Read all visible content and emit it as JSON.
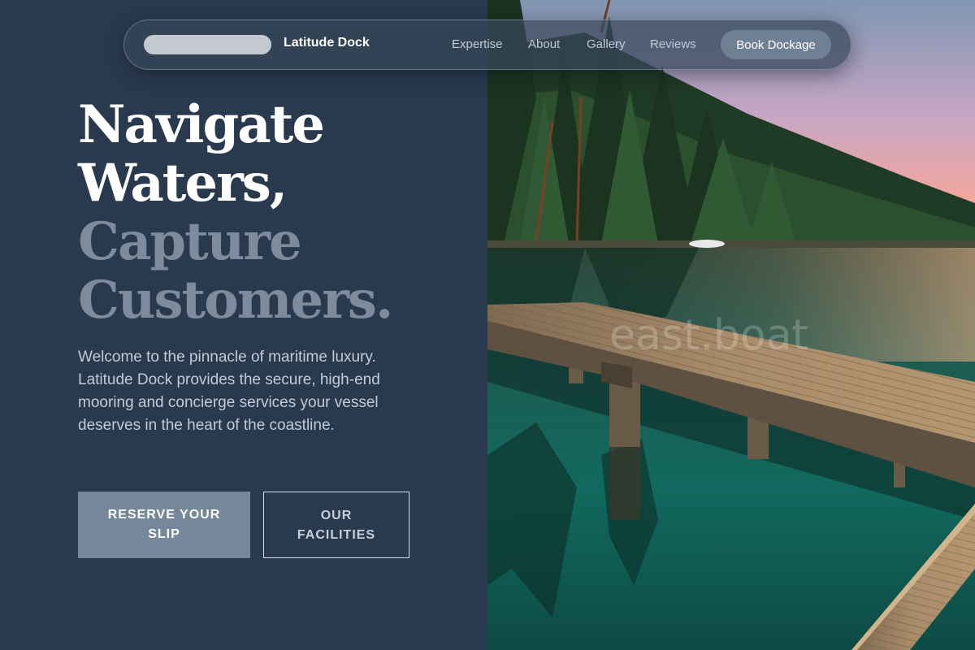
{
  "nav": {
    "brand": "Latitude Dock",
    "links": [
      "Expertise",
      "About",
      "Gallery",
      "Reviews"
    ],
    "cta": "Book Dockage"
  },
  "hero": {
    "title_lines": [
      "Navigate",
      "Waters,",
      "Capture",
      "Customers."
    ],
    "description": "Welcome to the pinnacle of maritime luxury. Latitude Dock provides the secure, high-end mooring and concierge services your vessel deserves in the heart of the coastline.",
    "primary_cta": "RESERVE YOUR SLIP",
    "secondary_cta": "OUR FACILITIES"
  },
  "image": {
    "subject": "wooden-dock-on-lake",
    "watermark": "east.boat"
  },
  "colors": {
    "background": "#2a3a4e",
    "accent": "#76879a",
    "muted_heading": "#7d8b9c",
    "body_text": "#c2cbd6"
  }
}
